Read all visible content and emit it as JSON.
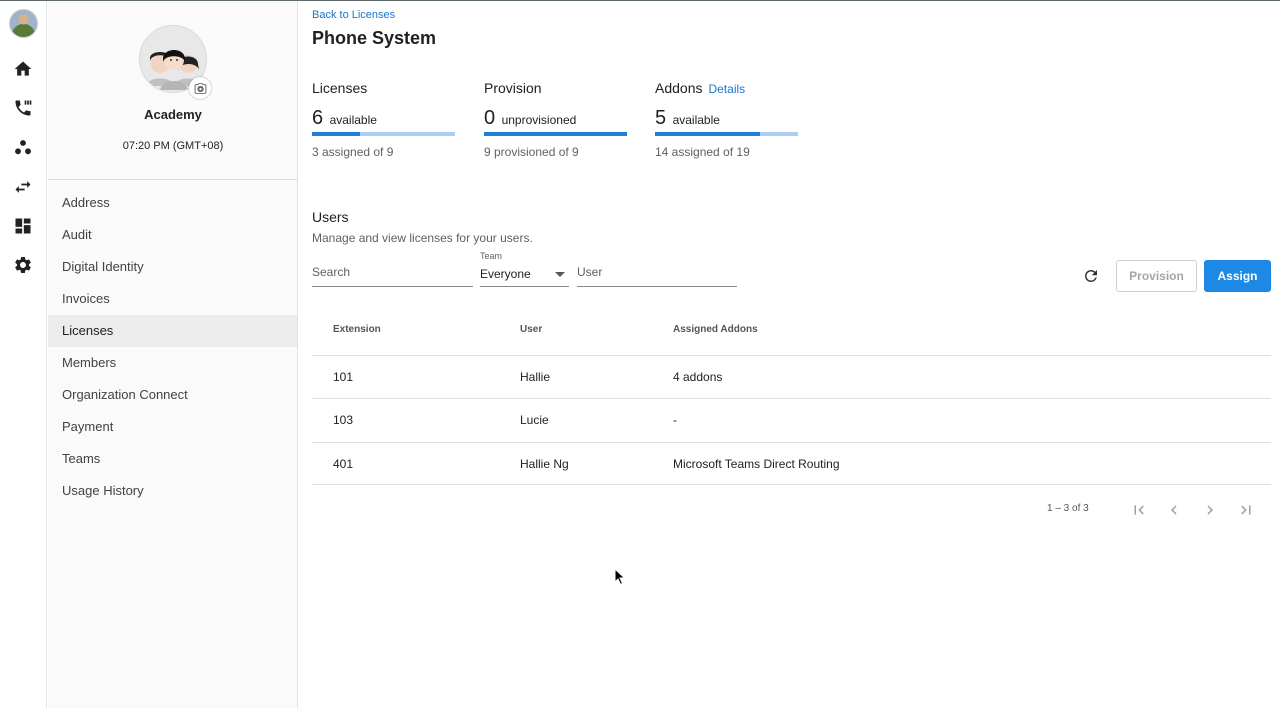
{
  "page": {
    "back_link": "Back to Licenses",
    "title": "Phone System"
  },
  "org": {
    "name": "Academy",
    "time": "07:20 PM (GMT+08)"
  },
  "menu": [
    {
      "label": "Address"
    },
    {
      "label": "Audit"
    },
    {
      "label": "Digital Identity"
    },
    {
      "label": "Invoices"
    },
    {
      "label": "Licenses",
      "active": true
    },
    {
      "label": "Members"
    },
    {
      "label": "Organization Connect"
    },
    {
      "label": "Payment"
    },
    {
      "label": "Teams"
    },
    {
      "label": "Usage History"
    }
  ],
  "stats": {
    "licenses": {
      "label": "Licenses",
      "number": "6",
      "unit": "available",
      "sub": "3 assigned of 9",
      "fill_fraction": 0.333
    },
    "provision": {
      "label": "Provision",
      "number": "0",
      "unit": "unprovisioned",
      "sub": "9 provisioned of 9",
      "fill_fraction": 1.0
    },
    "addons": {
      "label": "Addons",
      "link": "Details",
      "number": "5",
      "unit": "available",
      "sub": "14 assigned of 19",
      "fill_fraction": 0.737
    }
  },
  "users": {
    "title": "Users",
    "description": "Manage and view licenses for your users.",
    "search_placeholder": "Search",
    "team_label": "Team",
    "team_value": "Everyone",
    "user_placeholder": "User",
    "provision_label": "Provision",
    "assign_label": "Assign"
  },
  "table": {
    "headers": [
      "Extension",
      "User",
      "Assigned Addons"
    ],
    "rows": [
      [
        "101",
        "Hallie",
        "4 addons"
      ],
      [
        "103",
        "Lucie",
        "-"
      ],
      [
        "401",
        "Hallie Ng",
        "Microsoft Teams Direct Routing"
      ]
    ]
  },
  "pager": {
    "text": "1 – 3 of 3"
  },
  "colors": {
    "accent": "#1e88e5",
    "link": "#1976d2",
    "bar_fill": "#1e7fd6",
    "bar_track": "#a9cef0"
  }
}
